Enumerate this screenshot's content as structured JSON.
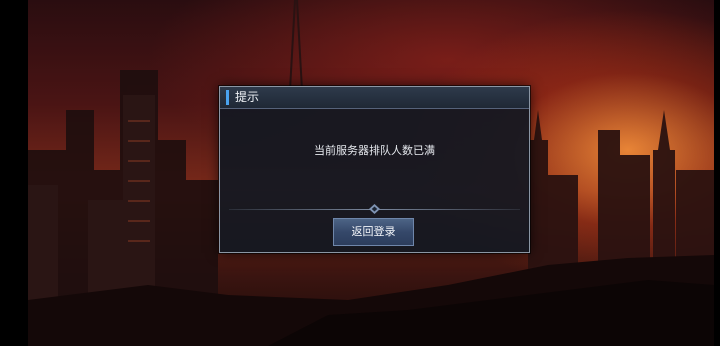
{
  "dialog": {
    "title": "提示",
    "message": "当前服务器排队人数已满",
    "button_label": "返回登录",
    "accent_color": "#4aa3f0"
  },
  "icons": {
    "divider_ornament": "diamond-ornament-icon"
  }
}
